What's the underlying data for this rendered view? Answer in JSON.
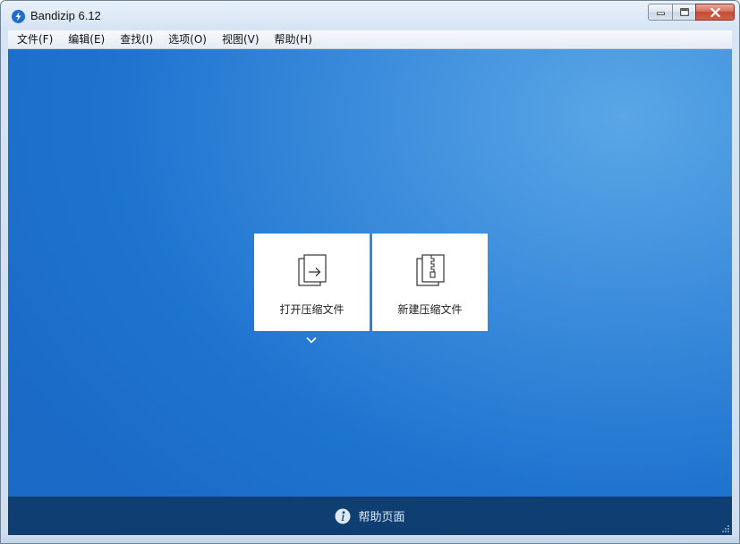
{
  "window": {
    "title": "Bandizip 6.12",
    "app_icon": "bandizip-logo-icon",
    "controls": [
      "minimize-icon",
      "maximize-icon",
      "close-icon"
    ]
  },
  "menubar": {
    "items": [
      {
        "label": "文件(F)"
      },
      {
        "label": "编辑(E)"
      },
      {
        "label": "查找(I)"
      },
      {
        "label": "选项(O)"
      },
      {
        "label": "视图(V)"
      },
      {
        "label": "帮助(H)"
      }
    ]
  },
  "main": {
    "tiles": [
      {
        "label": "打开压缩文件",
        "icon": "open-archive-icon"
      },
      {
        "label": "新建压缩文件",
        "icon": "new-archive-icon"
      }
    ],
    "dropdown_icon": "chevron-down-icon"
  },
  "footer": {
    "help_label": "帮助页面",
    "help_icon": "info-icon"
  },
  "colors": {
    "content_blue": "#1f74cf",
    "footer_navy": "#0f3f72",
    "close_red": "#c44a33"
  }
}
